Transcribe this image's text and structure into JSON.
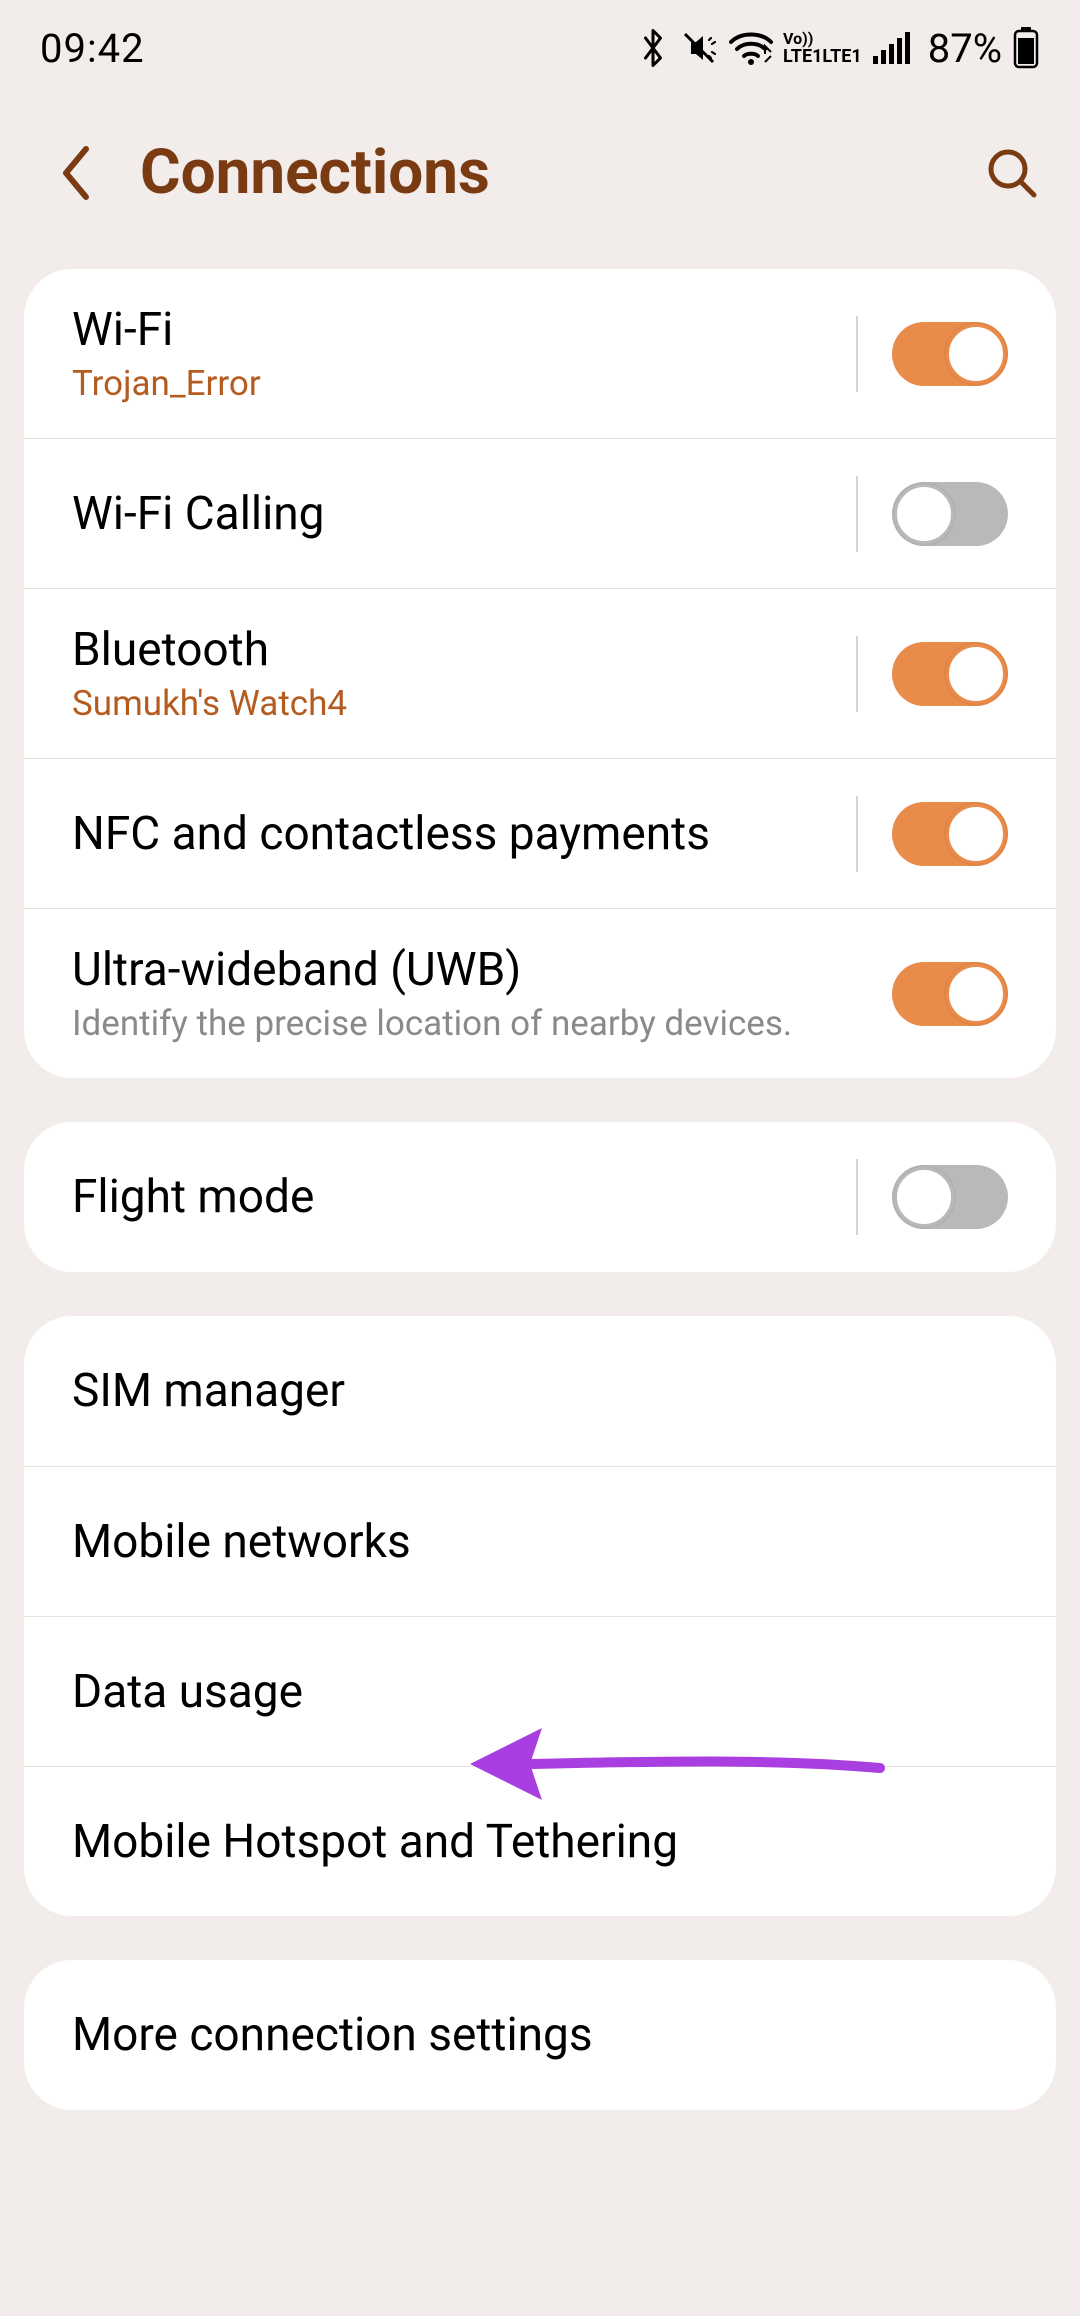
{
  "status_bar": {
    "time": "09:42",
    "battery_pct": "87%",
    "lte_label_top": "Vo))",
    "lte_label_bottom": "LTE1"
  },
  "header": {
    "title": "Connections"
  },
  "groups": [
    {
      "rows": [
        {
          "id": "wifi",
          "primary": "Wi-Fi",
          "secondary": "Trojan_Error",
          "toggle": true,
          "toggle_on": true
        },
        {
          "id": "wifi-calling",
          "primary": "Wi-Fi Calling",
          "toggle": true,
          "toggle_on": false
        },
        {
          "id": "bluetooth",
          "primary": "Bluetooth",
          "secondary": "Sumukh's Watch4",
          "toggle": true,
          "toggle_on": true
        },
        {
          "id": "nfc",
          "primary": "NFC and contactless payments",
          "toggle": true,
          "toggle_on": true
        },
        {
          "id": "uwb",
          "primary": "Ultra-wideband (UWB)",
          "desc": "Identify the precise location of nearby devices.",
          "toggle": true,
          "toggle_on": true,
          "no_divider": true
        }
      ]
    },
    {
      "rows": [
        {
          "id": "flight-mode",
          "primary": "Flight mode",
          "toggle": true,
          "toggle_on": false
        }
      ]
    },
    {
      "rows": [
        {
          "id": "sim-manager",
          "primary": "SIM manager"
        },
        {
          "id": "mobile-networks",
          "primary": "Mobile networks"
        },
        {
          "id": "data-usage",
          "primary": "Data usage"
        },
        {
          "id": "mobile-hotspot",
          "primary": "Mobile Hotspot and Tethering"
        }
      ]
    },
    {
      "rows": [
        {
          "id": "more-conn",
          "primary": "More connection settings"
        }
      ]
    }
  ],
  "colors": {
    "accent": "#7A3B12",
    "toggle_on": "#E98B4A",
    "annotation": "#A93FE0"
  }
}
